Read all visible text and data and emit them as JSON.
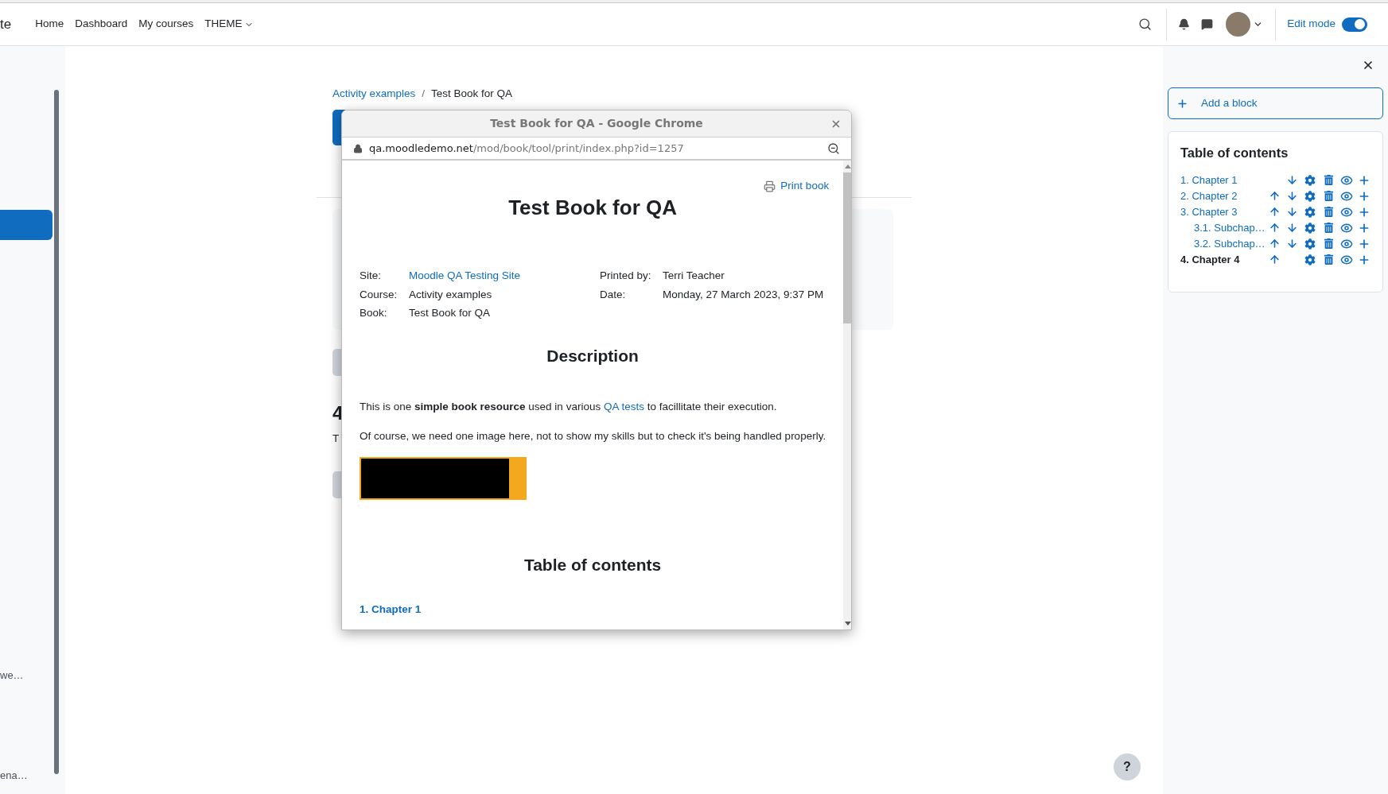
{
  "nav": {
    "site_fragment": "te",
    "links": [
      {
        "label": "Home",
        "dropdown": false
      },
      {
        "label": "Dashboard",
        "dropdown": false
      },
      {
        "label": "My courses",
        "dropdown": false
      },
      {
        "label": "THEME",
        "dropdown": true
      }
    ],
    "edit_mode": {
      "label": "Edit mode",
      "on": true
    }
  },
  "left_drawer": {
    "items": [
      {
        "label": "we…"
      },
      {
        "label": "ena…"
      }
    ]
  },
  "breadcrumb": {
    "separator": "/",
    "items": [
      {
        "label": "Activity examples",
        "link": true
      },
      {
        "label": "Test Book for QA",
        "link": false
      }
    ]
  },
  "page": {
    "heading_fragment": "4",
    "text_fragment": "T"
  },
  "popup": {
    "title": "Test Book for QA - Google Chrome",
    "url_host": "qa.moodledemo.net",
    "url_path": "/mod/book/tool/print/index.php?id=1257",
    "print_link": "Print book",
    "book_title": "Test Book for QA",
    "meta_left": [
      {
        "label": "Site:",
        "value": "Moodle QA Testing Site",
        "link": true
      },
      {
        "label": "Course:",
        "value": "Activity examples",
        "link": false
      },
      {
        "label": "Book:",
        "value": "Test Book for QA",
        "link": false
      }
    ],
    "meta_right": [
      {
        "label": "Printed by:",
        "value": "Terri Teacher"
      },
      {
        "label": "Date:",
        "value": "Monday, 27 March 2023, 9:37 PM"
      }
    ],
    "description_heading": "Description",
    "paragraph_1": {
      "before": "This is one **simple book resource** used in various ",
      "link": "QA tests",
      "after": " to facillitate their execution."
    },
    "paragraph_2": "Of course, we need one image here, not to show my skills but to check it's being handled properly.",
    "toc_heading": "Table of contents",
    "toc_items": [
      {
        "label": "1. Chapter 1"
      }
    ]
  },
  "right_drawer": {
    "add_block": "Add a block",
    "toc": {
      "title": "Table of contents",
      "items": [
        {
          "label": "1. Chapter 1",
          "current": false,
          "move_up": false,
          "move_down": true
        },
        {
          "label": "2. Chapter 2",
          "current": false,
          "move_up": true,
          "move_down": true
        },
        {
          "label": "3. Chapter 3",
          "current": false,
          "move_up": true,
          "move_down": true,
          "children": [
            {
              "label": "3.1. Subchap…",
              "current": false,
              "move_up": true,
              "move_down": true
            },
            {
              "label": "3.2. Subchap…",
              "current": false,
              "move_up": true,
              "move_down": true
            }
          ]
        },
        {
          "label": "4. Chapter 4",
          "current": true,
          "move_up": true,
          "move_down": false
        }
      ]
    }
  },
  "help": {
    "label": "?"
  }
}
